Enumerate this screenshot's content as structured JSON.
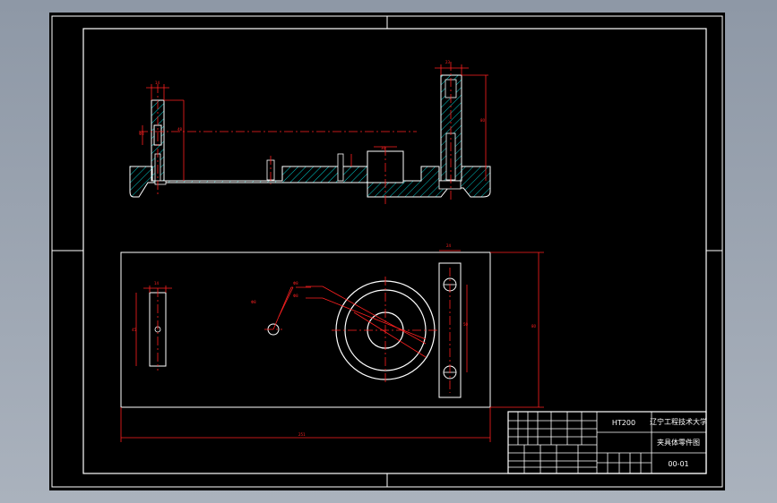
{
  "title_block": {
    "material": "HT200",
    "school": "辽宁工程技术大学",
    "drawing_name": "夹具体零件图",
    "drawing_no": "00-01"
  },
  "colors": {
    "background": "#000000",
    "frame": "#ffffff",
    "outline": "#ffffff",
    "section_fill": "#00c8c8",
    "dimension": "#ff2020",
    "center_line": "#ff2020"
  }
}
